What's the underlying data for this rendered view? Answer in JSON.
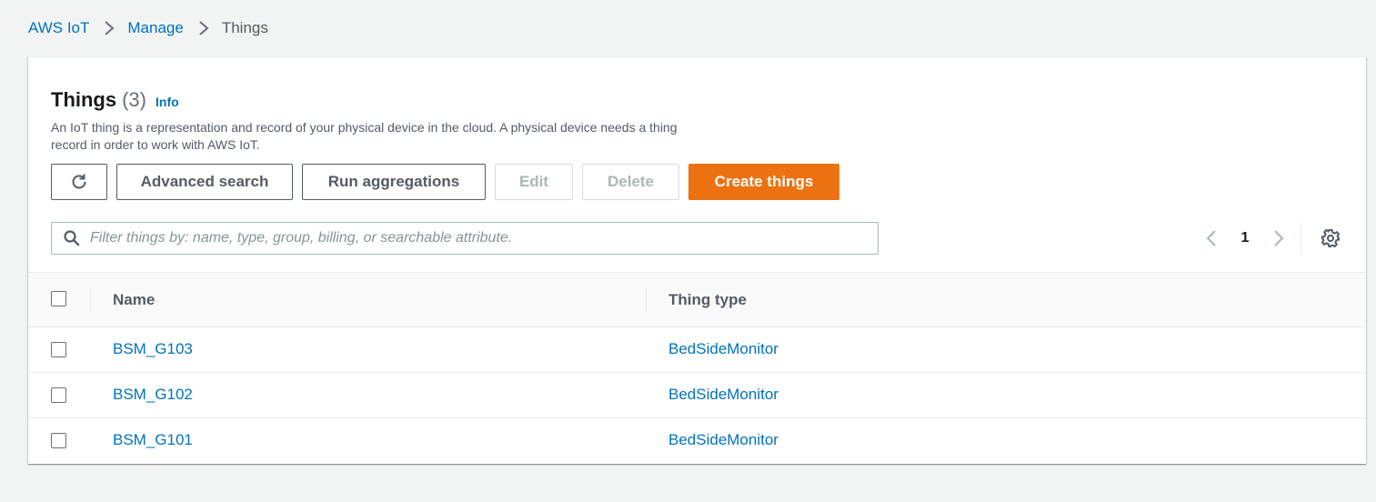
{
  "breadcrumb": {
    "items": [
      "AWS IoT",
      "Manage",
      "Things"
    ]
  },
  "header": {
    "title": "Things",
    "count": "(3)",
    "info": "Info",
    "description": "An IoT thing is a representation and record of your physical device in the cloud. A physical device needs a thing record in order to work with AWS IoT."
  },
  "actions": {
    "refresh_icon": "refresh-icon",
    "advanced_search": "Advanced search",
    "run_aggregations": "Run aggregations",
    "edit": "Edit",
    "delete": "Delete",
    "create": "Create things"
  },
  "search": {
    "placeholder": "Filter things by: name, type, group, billing, or searchable attribute.",
    "value": ""
  },
  "pagination": {
    "current_page": "1"
  },
  "table": {
    "columns": [
      "Name",
      "Thing type"
    ],
    "rows": [
      {
        "name": "BSM_G103",
        "thing_type": "BedSideMonitor",
        "selected": false
      },
      {
        "name": "BSM_G102",
        "thing_type": "BedSideMonitor",
        "selected": false
      },
      {
        "name": "BSM_G101",
        "thing_type": "BedSideMonitor",
        "selected": false
      }
    ]
  },
  "colors": {
    "link": "#0073bb",
    "primary": "#ec7211",
    "background": "#f2f3f3"
  }
}
